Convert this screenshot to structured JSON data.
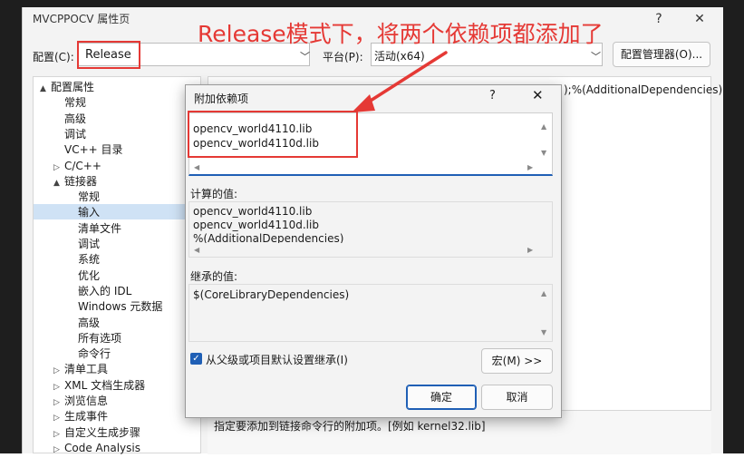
{
  "window": {
    "title": "MVCPPOCV 属性页",
    "help_glyph": "?",
    "close_glyph": "✕"
  },
  "annotation": "Release模式下，将两个依赖项都添加了",
  "toolbar": {
    "config_label": "配置(C):",
    "config_value": "Release",
    "platform_label": "平台(P):",
    "platform_value": "活动(x64)",
    "config_manager_label": "配置管理器(O)..."
  },
  "tree": {
    "items": [
      {
        "label": "配置属性",
        "toggle": "▲"
      },
      {
        "label": "常规"
      },
      {
        "label": "高级"
      },
      {
        "label": "调试"
      },
      {
        "label": "VC++ 目录"
      },
      {
        "label": "C/C++",
        "toggle": "▷"
      },
      {
        "label": "链接器",
        "toggle": "▲"
      },
      {
        "label": "常规"
      },
      {
        "label": "输入",
        "selected": true
      },
      {
        "label": "清单文件"
      },
      {
        "label": "调试"
      },
      {
        "label": "系统"
      },
      {
        "label": "优化"
      },
      {
        "label": "嵌入的 IDL"
      },
      {
        "label": "Windows 元数据"
      },
      {
        "label": "高级"
      },
      {
        "label": "所有选项"
      },
      {
        "label": "命令行"
      },
      {
        "label": "清单工具",
        "toggle": "▷"
      },
      {
        "label": "XML 文档生成器",
        "toggle": "▷"
      },
      {
        "label": "浏览信息",
        "toggle": "▷"
      },
      {
        "label": "生成事件",
        "toggle": "▷"
      },
      {
        "label": "自定义生成步骤",
        "toggle": "▷"
      },
      {
        "label": "Code Analysis",
        "toggle": "▷"
      }
    ]
  },
  "grid": {
    "row_value_tail": ");%(AdditionalDependencies)"
  },
  "description": "指定要添加到链接命令行的附加项。[例如 kernel32.lib]",
  "dialog": {
    "title": "附加依赖项",
    "help_glyph": "?",
    "close_glyph": "✕",
    "edit_lines": [
      "opencv_world4110.lib",
      "opencv_world4110d.lib"
    ],
    "computed_label": "计算的值:",
    "computed_lines": [
      "opencv_world4110.lib",
      "opencv_world4110d.lib",
      "%(AdditionalDependencies)"
    ],
    "inherited_label": "继承的值:",
    "inherited_lines": [
      "$(CoreLibraryDependencies)"
    ],
    "inherit_checkbox_label": "从父级或项目默认设置继承(I)",
    "inherit_checked": true,
    "macro_button": "宏(M) >>",
    "ok_button": "确定",
    "cancel_button": "取消"
  },
  "colors": {
    "annotation_red": "#e53935",
    "accent_blue": "#1f5fb5",
    "selection": "#cfe2f5"
  }
}
